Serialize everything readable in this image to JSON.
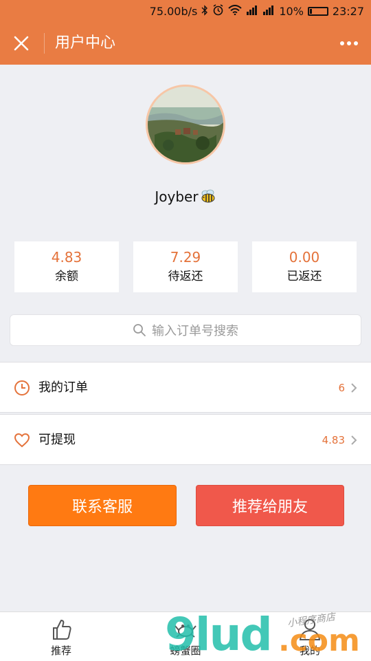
{
  "status_bar": {
    "network_speed": "75.00b/s",
    "battery": "10%",
    "time": "23:27",
    "icons": [
      "bluetooth-icon",
      "alarm-icon",
      "wifi-icon",
      "signal-icon",
      "signal-icon",
      "battery-icon"
    ]
  },
  "header": {
    "title": "用户中心",
    "close_icon": "close-icon",
    "more_icon": "more-icon"
  },
  "profile": {
    "username": "Joyber",
    "emoji": "bee-icon"
  },
  "stats": [
    {
      "value": "4.83",
      "label": "余额"
    },
    {
      "value": "7.29",
      "label": "待返还"
    },
    {
      "value": "0.00",
      "label": "已返还"
    }
  ],
  "search": {
    "placeholder": "输入订单号搜索",
    "icon": "search-icon"
  },
  "menu": [
    {
      "label": "我的订单",
      "count": "6",
      "icon": "clock-icon"
    },
    {
      "label": "可提现",
      "count": "4.83",
      "icon": "heart-icon"
    }
  ],
  "buttons": {
    "contact": "联系客服",
    "share": "推荐给朋友"
  },
  "tabs": [
    {
      "label": "推荐",
      "icon": "thumbs-up-icon"
    },
    {
      "label": "螃蟹圈",
      "icon": "crab-icon"
    },
    {
      "label": "我的",
      "icon": "user-icon"
    }
  ],
  "watermark": {
    "main": "9lud",
    "suffix": ".com",
    "side": "小程序商店"
  },
  "colors": {
    "accent": "#e97c43",
    "value_text": "#e4723a",
    "contact_button": "#ff7a12",
    "share_button": "#f0584b",
    "background": "#eeeff3"
  }
}
